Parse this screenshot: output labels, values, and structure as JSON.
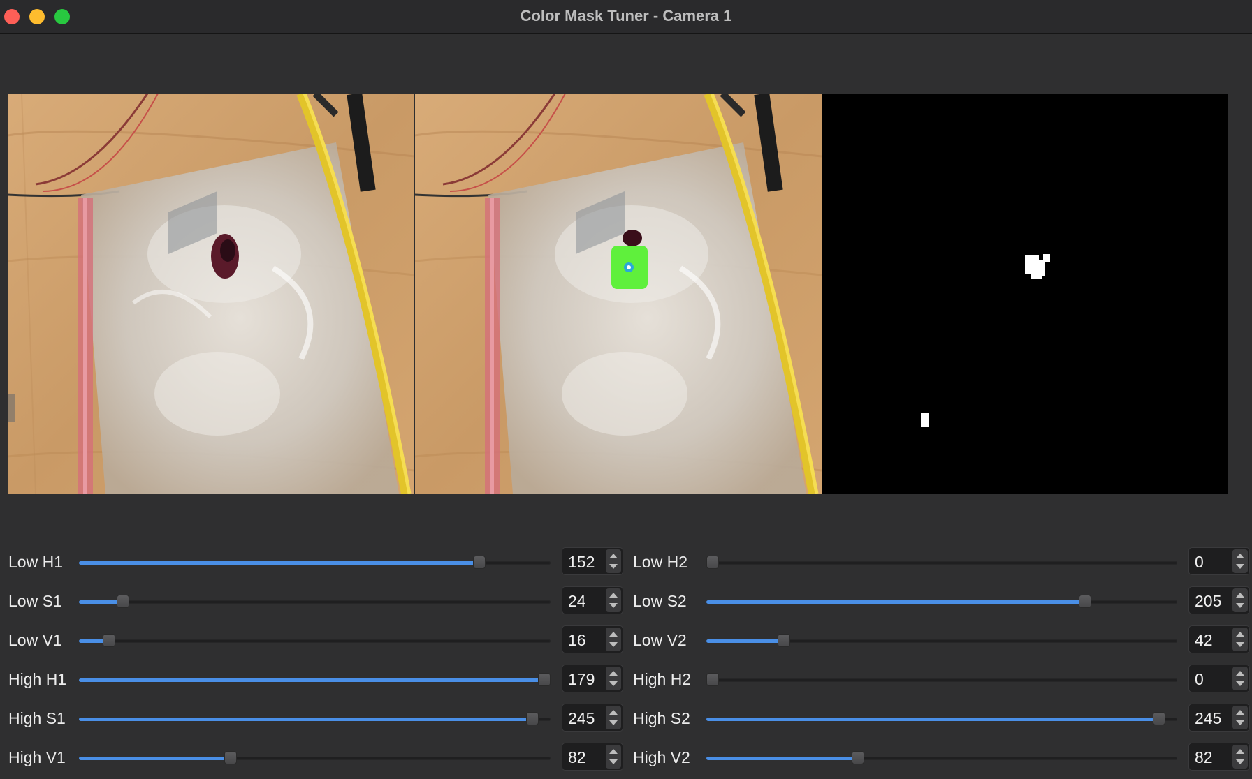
{
  "window": {
    "title": "Color Mask Tuner - Camera 1"
  },
  "colors": {
    "accent": "#4a8fe6",
    "detection_box": "#5ff03c",
    "mask_blob": "#ffffff"
  },
  "panels": {
    "original": {
      "name": "original-camera-view"
    },
    "annotated": {
      "name": "annotated-detection-view"
    },
    "mask": {
      "name": "binary-mask-view"
    }
  },
  "sliders": {
    "left": [
      {
        "label": "Low H1",
        "value": "152",
        "max": 179,
        "level": 0.849
      },
      {
        "label": "Low S1",
        "value": "24",
        "max": 255,
        "level": 0.094
      },
      {
        "label": "Low V1",
        "value": "16",
        "max": 255,
        "level": 0.063
      },
      {
        "label": "High H1",
        "value": "179",
        "max": 179,
        "level": 1.0
      },
      {
        "label": "High S1",
        "value": "245",
        "max": 255,
        "level": 0.961
      },
      {
        "label": "High V1",
        "value": "82",
        "max": 255,
        "level": 0.322
      }
    ],
    "right": [
      {
        "label": "Low H2",
        "value": "0",
        "max": 179,
        "level": 0.0
      },
      {
        "label": "Low S2",
        "value": "205",
        "max": 255,
        "level": 0.804
      },
      {
        "label": "Low V2",
        "value": "42",
        "max": 255,
        "level": 0.165
      },
      {
        "label": "High H2",
        "value": "0",
        "max": 179,
        "level": 0.0
      },
      {
        "label": "High S2",
        "value": "245",
        "max": 255,
        "level": 0.961
      },
      {
        "label": "High V2",
        "value": "82",
        "max": 255,
        "level": 0.322
      }
    ]
  }
}
